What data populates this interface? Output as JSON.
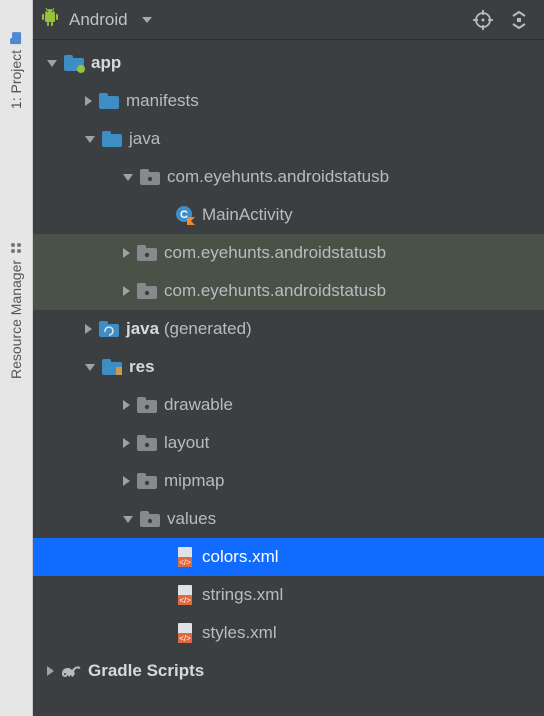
{
  "header": {
    "view_label": "Android"
  },
  "sidebar": {
    "tabs": [
      {
        "label": "1: Project"
      },
      {
        "label": "Resource Manager"
      }
    ]
  },
  "tree": {
    "app": "app",
    "manifests": "manifests",
    "java": "java",
    "pkg_main": "com.eyehunts.androidstatusb",
    "main_activity": "MainActivity",
    "pkg_androidtest": "com.eyehunts.androidstatusb",
    "pkg_test": "com.eyehunts.androidstatusb",
    "java_gen": "java",
    "java_gen_suffix": "(generated)",
    "res": "res",
    "drawable": "drawable",
    "layout": "layout",
    "mipmap": "mipmap",
    "values": "values",
    "colors_xml": "colors.xml",
    "strings_xml": "strings.xml",
    "styles_xml": "styles.xml",
    "gradle_scripts": "Gradle Scripts"
  }
}
